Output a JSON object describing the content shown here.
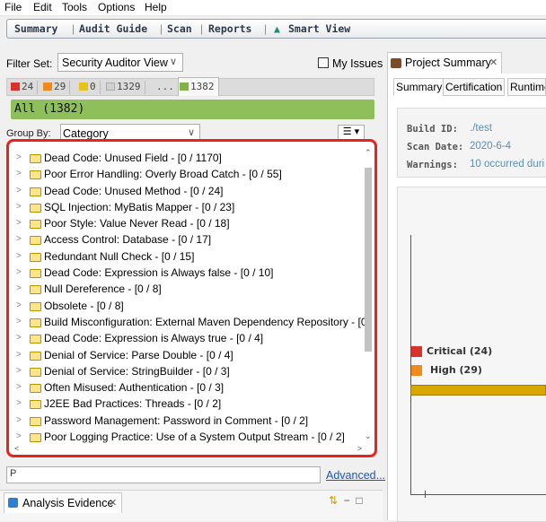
{
  "menu": [
    "File",
    "Edit",
    "Tools",
    "Options",
    "Help"
  ],
  "perspectives": [
    "Summary",
    "Audit Guide",
    "Scan",
    "Reports",
    "Smart View"
  ],
  "filter": {
    "label": "Filter Set:",
    "value": "Security Auditor View",
    "my_issues": "My Issues"
  },
  "priority_tabs": [
    {
      "count": "24",
      "color": "#d9322b"
    },
    {
      "count": "29",
      "color": "#f08a1a"
    },
    {
      "count": "0",
      "color": "#e8c21a"
    },
    {
      "count": "1329",
      "color": "#d0d0d0"
    },
    {
      "count": "...",
      "color": ""
    },
    {
      "count": "1382",
      "color": "#7fb347"
    }
  ],
  "all_label": "All (1382)",
  "group_by": {
    "label": "Group By:",
    "value": "Category"
  },
  "tree_items": [
    "Dead Code: Unused Field - [0 / 1170]",
    "Poor Error Handling: Overly Broad Catch - [0 / 55]",
    "Dead Code: Unused Method - [0 / 24]",
    "SQL Injection: MyBatis Mapper - [0 / 23]",
    "Poor Style: Value Never Read - [0 / 18]",
    "Access Control: Database - [0 / 17]",
    "Redundant Null Check - [0 / 15]",
    "Dead Code: Expression is Always false - [0 / 10]",
    "Null Dereference - [0 / 8]",
    "Obsolete - [0 / 8]",
    "Build Misconfiguration: External Maven Dependency Repository - [0",
    "Dead Code: Expression is Always true - [0 / 4]",
    "Denial of Service: Parse Double - [0 / 4]",
    "Denial of Service: StringBuilder - [0 / 3]",
    "Often Misused: Authentication - [0 / 3]",
    "J2EE Bad Practices: Threads - [0 / 2]",
    "Password Management: Password in Comment - [0 / 2]",
    "Poor Logging Practice: Use of a System Output Stream - [0 / 2]"
  ],
  "search": {
    "icon": "P",
    "value": ""
  },
  "advanced_link": "Advanced...",
  "evidence_tab": "Analysis Evidence",
  "project_summary": {
    "tab": "Project Summary",
    "subtabs": [
      "Summary",
      "Certification",
      "Runtime"
    ],
    "build_id_label": "Build ID:",
    "build_id": "./test",
    "scan_date_label": "Scan Date:",
    "scan_date": "2020-6-4",
    "warnings_label": "Warnings:",
    "warnings": "10 occurred duri"
  },
  "legend": [
    {
      "label": "Critical (24)",
      "color": "#d9322b"
    },
    {
      "label": "High (29)",
      "color": "#f08a1a"
    }
  ]
}
